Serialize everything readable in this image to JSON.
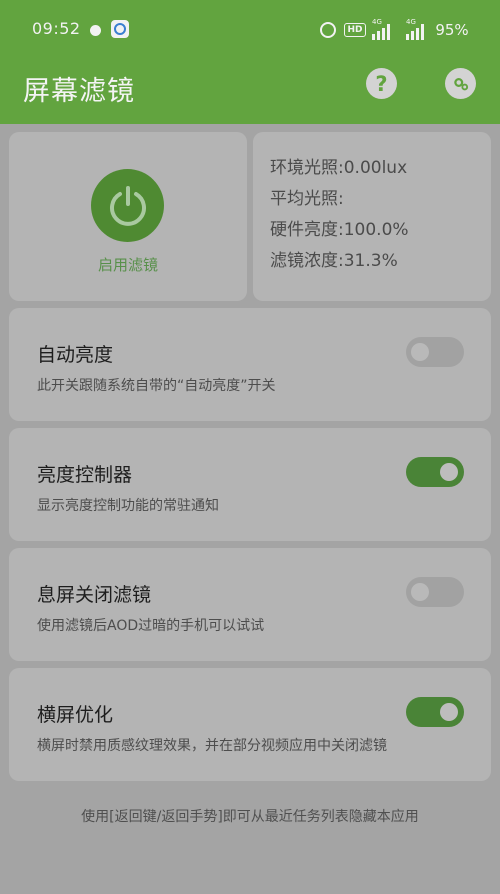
{
  "status_bar": {
    "time": "09:52",
    "hd_label": "HD",
    "network1": "4G",
    "network2": "4G",
    "battery": "95%",
    "icons": [
      "lightbulb-icon",
      "app-notification-icon",
      "alarm-icon",
      "hd-icon",
      "signal-icon",
      "signal-icon"
    ]
  },
  "app_bar": {
    "title": "屏幕滤镜",
    "help_label": "?",
    "settings_icon": "gear-icon"
  },
  "filter_card": {
    "button_icon": "power-icon",
    "label": "启用滤镜"
  },
  "info": {
    "ambient_light": "环境光照:0.00lux",
    "average_light": "平均光照:",
    "hardware_brightness": "硬件亮度:100.0%",
    "filter_density": "滤镜浓度:31.3%"
  },
  "settings": [
    {
      "title": "自动亮度",
      "description": "此开关跟随系统自带的“自动亮度”开关",
      "enabled": false
    },
    {
      "title": "亮度控制器",
      "description": "显示亮度控制功能的常驻通知",
      "enabled": true
    },
    {
      "title": "息屏关闭滤镜",
      "description": "使用滤镜后AOD过暗的手机可以试试",
      "enabled": false
    },
    {
      "title": "横屏优化",
      "description": "横屏时禁用质感纹理效果，并在部分视频应用中关闭滤镜",
      "enabled": true
    }
  ],
  "footer": "使用[返回键/返回手势]即可从最近任务列表隐藏本应用",
  "colors": {
    "app_bar": "#62a43f",
    "accent": "#4f8a32",
    "overlay_background": "#a4a4a4",
    "card": "#b4b4b4"
  }
}
